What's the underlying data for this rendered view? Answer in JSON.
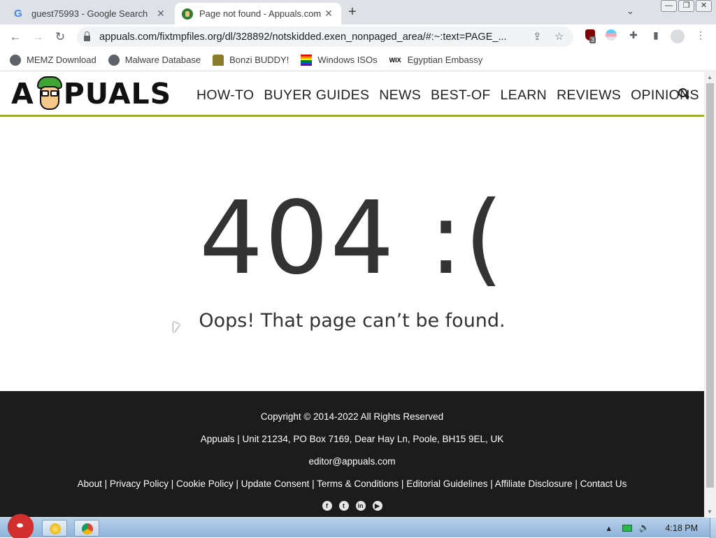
{
  "browser": {
    "tabs": [
      {
        "title": "guest75993 - Google Search",
        "active": false,
        "favicon": "google-icon"
      },
      {
        "title": "Page not found - Appuals.com",
        "active": true,
        "favicon": "appuals-icon"
      }
    ],
    "new_tab": "+",
    "url": "appuals.com/fixtmpfiles.org/dl/328892/notskidded.exen_nonpaged_area/#:~:text=PAGE_...",
    "extension_badge": "3",
    "bookmarks": [
      {
        "label": "MEMZ Download",
        "icon": "globe-icon"
      },
      {
        "label": "Malware Database",
        "icon": "globe-icon"
      },
      {
        "label": "Bonzi BUDDY!",
        "icon": "bonzi-icon"
      },
      {
        "label": "Windows ISOs",
        "icon": "rainbow-flag-icon"
      },
      {
        "label": "Egyptian Embassy",
        "icon": "wix-icon"
      }
    ]
  },
  "site": {
    "logo_text": "APPUALS",
    "nav": [
      "HOW-TO",
      "BUYER GUIDES",
      "NEWS",
      "BEST-OF",
      "LEARN",
      "REVIEWS",
      "OPINIONS"
    ],
    "accent_color": "#9bb030"
  },
  "error": {
    "code": "404 :(",
    "message": "Oops! That page can’t be found."
  },
  "footer": {
    "copyright": "Copyright © 2014-2022 All Rights Reserved",
    "address": "Appuals | Unit 21234, PO Box 7169, Dear Hay Ln, Poole, BH15 9EL, UK",
    "email": "editor@appuals.com",
    "links": [
      "About",
      "Privacy Policy",
      "Cookie Policy",
      "Update Consent",
      "Terms & Conditions",
      "Editorial Guidelines",
      "Affiliate Disclosure",
      "Contact Us"
    ],
    "social": [
      "facebook-icon",
      "twitter-icon",
      "linkedin-icon",
      "youtube-icon"
    ]
  },
  "taskbar": {
    "clock": "4:18 PM"
  }
}
